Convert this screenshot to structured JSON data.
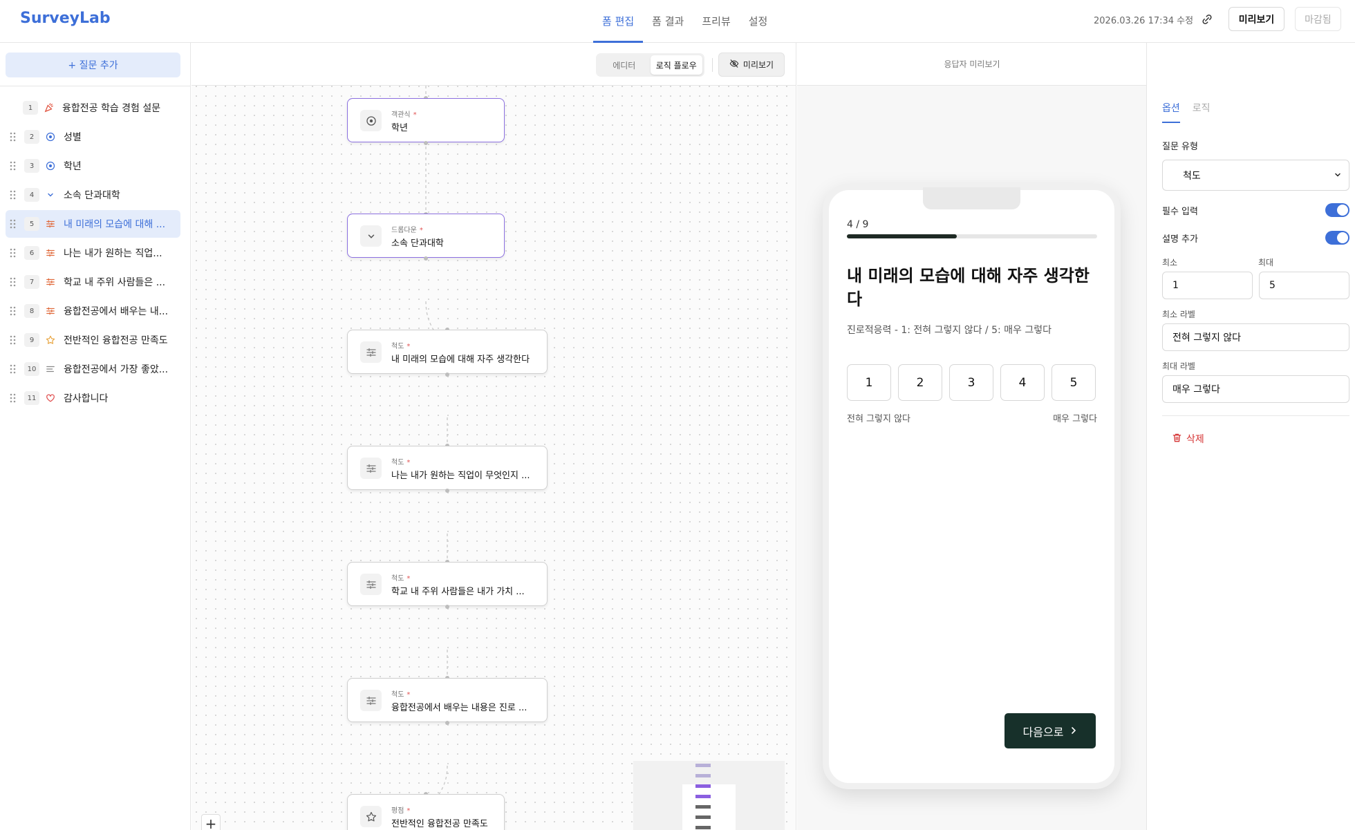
{
  "app": {
    "brand": "SurveyLab",
    "nav": [
      "폼 편집",
      "폼 결과",
      "프리뷰",
      "설정"
    ],
    "active_nav": 0,
    "timestamp": "2026.03.26 17:34 수정",
    "preview_button": "미리보기",
    "closed_button": "마감됨",
    "accent_color": "#3d6fd8"
  },
  "sidebar": {
    "add_question": "+ 질문 추가",
    "items": [
      {
        "num": "1",
        "icon": "party-icon",
        "label": "융합전공 학습 경험 설문"
      },
      {
        "num": "2",
        "icon": "radio-icon",
        "label": "성별"
      },
      {
        "num": "3",
        "icon": "radio-icon",
        "label": "학년"
      },
      {
        "num": "4",
        "icon": "chevron-down-icon",
        "label": "소속 단과대학"
      },
      {
        "num": "5",
        "icon": "scale-icon",
        "label": "내 미래의 모습에 대해 ..."
      },
      {
        "num": "6",
        "icon": "scale-icon",
        "label": "나는 내가 원하는 직업..."
      },
      {
        "num": "7",
        "icon": "scale-icon",
        "label": "학교 내 주위 사람들은 ..."
      },
      {
        "num": "8",
        "icon": "scale-icon",
        "label": "융합전공에서 배우는 내..."
      },
      {
        "num": "9",
        "icon": "star-icon",
        "label": "전반적인 융합전공 만족도"
      },
      {
        "num": "10",
        "icon": "text-lines-icon",
        "label": "융합전공에서 가장 좋았..."
      },
      {
        "num": "11",
        "icon": "heart-icon",
        "label": "감사합니다"
      }
    ],
    "active_index": 4
  },
  "canvas": {
    "modes": [
      "에디터",
      "로직 플로우"
    ],
    "active_mode": 1,
    "preview_toggle": "미리보기",
    "nodes": [
      {
        "type": "객관식",
        "title": "학년",
        "icon": "radio-icon"
      },
      {
        "type": "드롭다운",
        "title": "소속 단과대학",
        "icon": "chevron-down-icon"
      },
      {
        "type": "척도",
        "title": "내 미래의 모습에 대해 자주 생각한다",
        "icon": "scale-icon"
      },
      {
        "type": "척도",
        "title": "나는 내가 원하는 직업이 무엇인지 ...",
        "icon": "scale-icon"
      },
      {
        "type": "척도",
        "title": "학교 내 주위 사람들은 내가 가치 ...",
        "icon": "scale-icon"
      },
      {
        "type": "척도",
        "title": "융합전공에서 배우는 내용은 진로 ...",
        "icon": "scale-icon"
      },
      {
        "type": "평점",
        "title": "전반적인 융합전공 만족도",
        "icon": "star-icon"
      }
    ],
    "required_mark": "*",
    "zoom_in": "+"
  },
  "preview": {
    "header": "응답자 미리보기",
    "progress_text": "4 / 9",
    "progress_fraction": 0.44,
    "question": "내 미래의 모습에 대해 자주 생각한다",
    "description": "진로적응력 - 1: 전혀 그렇지 않다 / 5: 매우 그렇다",
    "scale": [
      "1",
      "2",
      "3",
      "4",
      "5"
    ],
    "min_label": "전혀 그렇지 않다",
    "max_label": "매우 그렇다",
    "next_button": "다음으로"
  },
  "panel": {
    "tabs": [
      "옵션",
      "로직"
    ],
    "active_tab": 0,
    "type_label": "질문 유형",
    "type_value": "척도",
    "required_label": "필수 입력",
    "required_on": true,
    "desc_label": "설명 추가",
    "desc_on": true,
    "min_label": "최소",
    "min_value": "1",
    "max_label": "최대",
    "max_value": "5",
    "min_text_label": "최소 라벨",
    "min_text_value": "전혀 그렇지 않다",
    "max_text_label": "최대 라벨",
    "max_text_value": "매우 그렇다",
    "delete_label": "삭제"
  }
}
